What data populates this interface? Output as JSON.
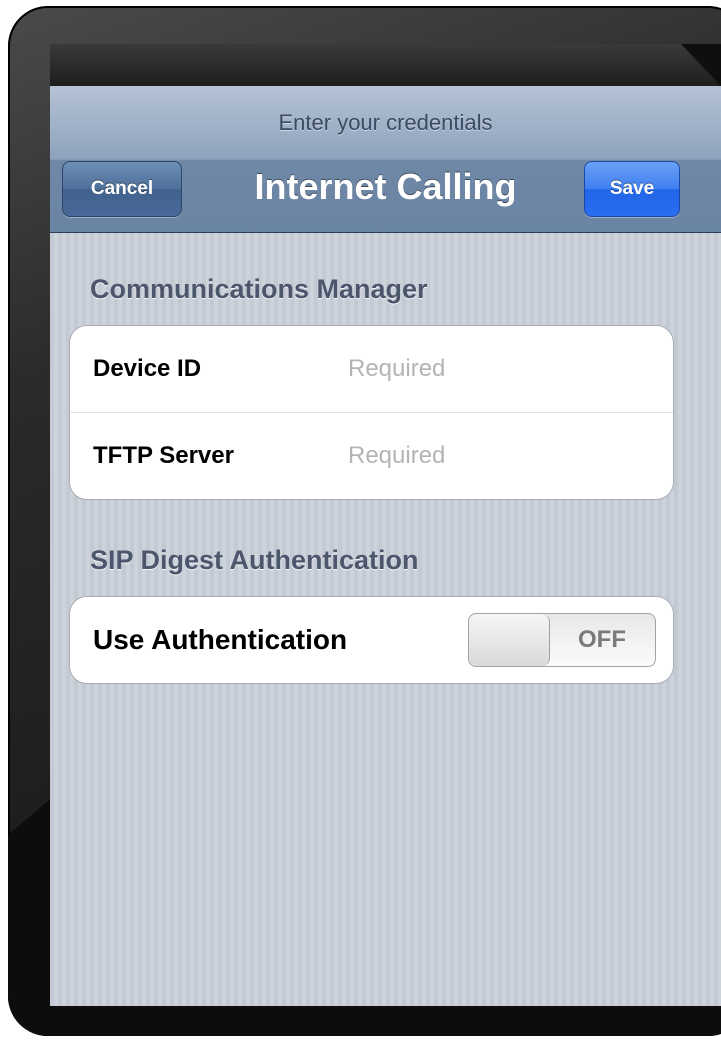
{
  "navbar": {
    "prompt": "Enter your credentials",
    "title": "Internet Calling",
    "cancel_label": "Cancel",
    "save_label": "Save"
  },
  "sections": {
    "communications_manager": {
      "header": "Communications Manager",
      "device_id_label": "Device ID",
      "device_id_value": "",
      "device_id_placeholder": "Required",
      "tftp_server_label": "TFTP Server",
      "tftp_server_value": "",
      "tftp_server_placeholder": "Required"
    },
    "sip_digest": {
      "header": "SIP Digest Authentication",
      "use_auth_label": "Use Authentication",
      "toggle_state": "OFF"
    }
  },
  "colors": {
    "save_button": "#2a6ef0",
    "navbar": "#8ea2bc",
    "background": "#c8ced6"
  }
}
